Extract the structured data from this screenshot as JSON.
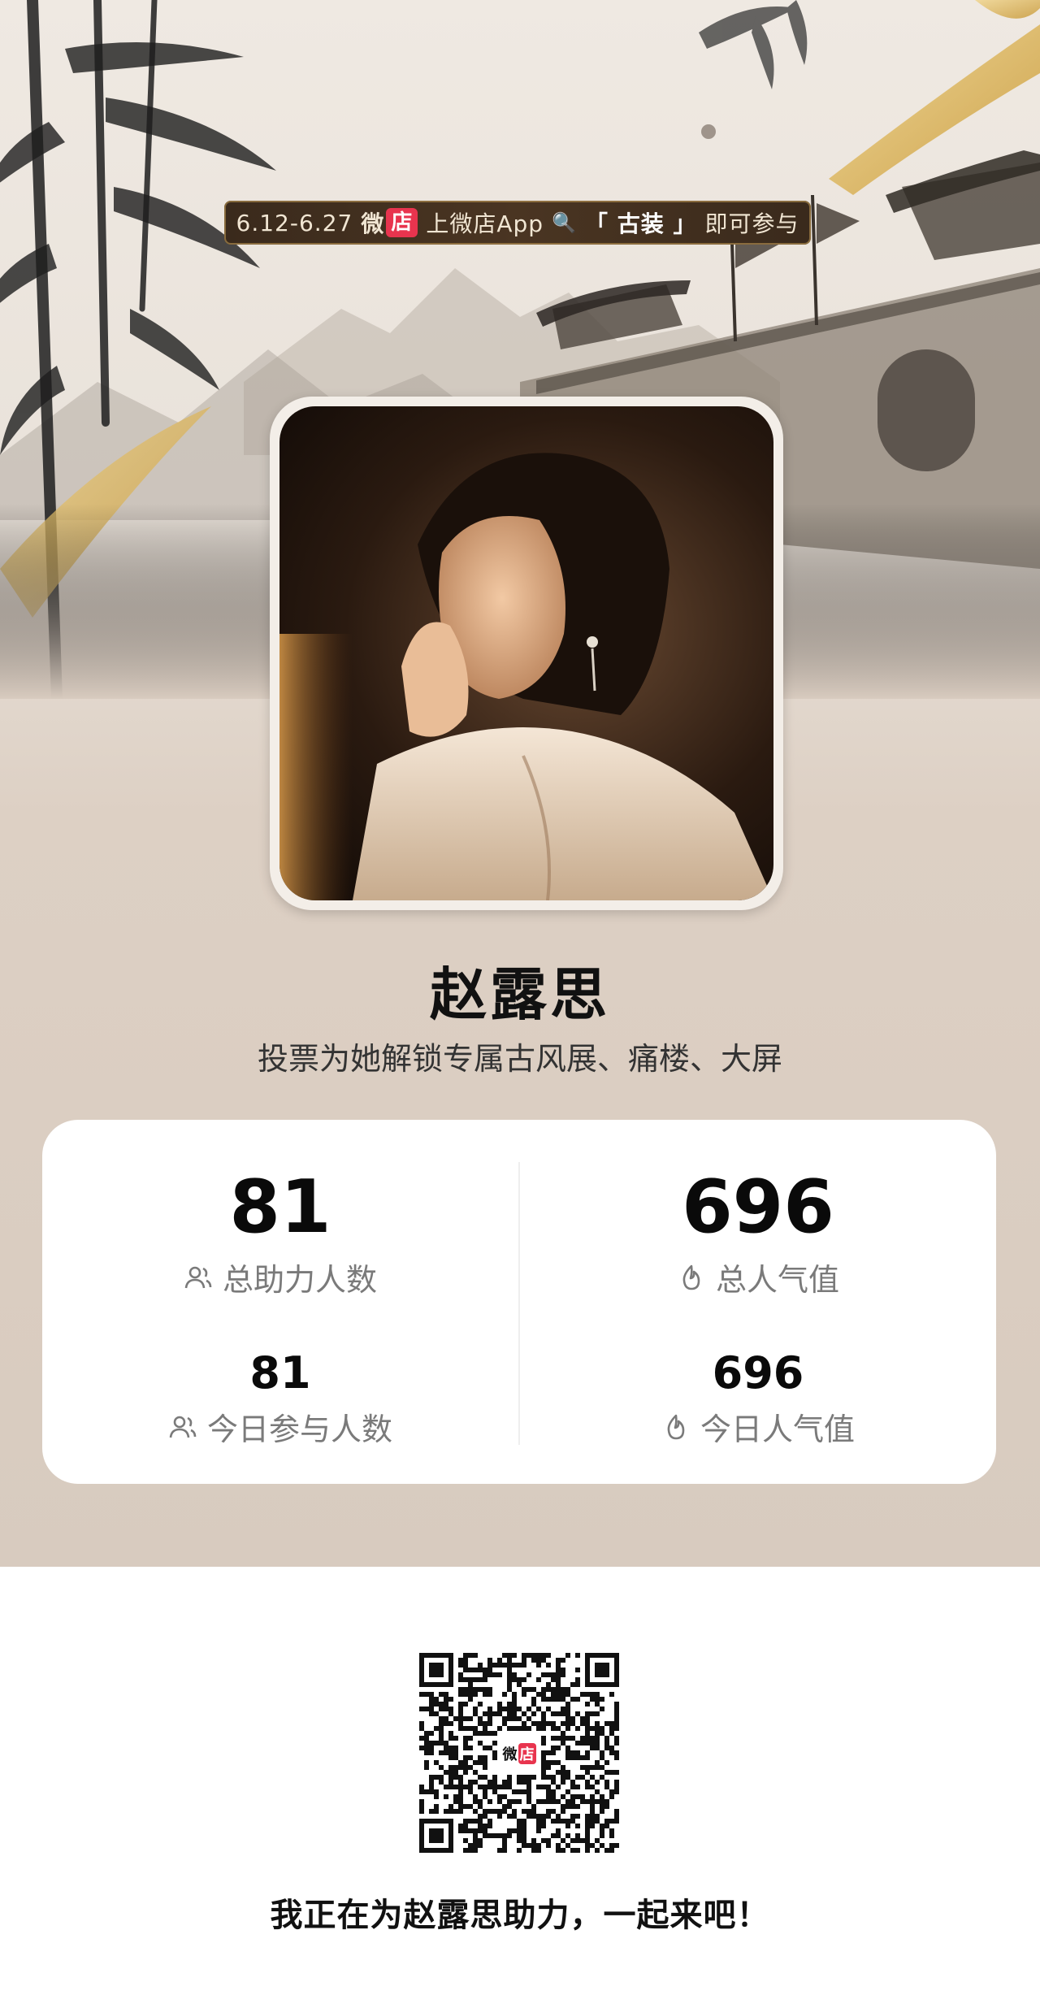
{
  "banner": {
    "dates": "6.12-6.27",
    "shop_prefix": "微",
    "shop_box": "店",
    "app_text": "上微店App",
    "search_icon": "magnifier-icon",
    "keyword": "「 古装 」",
    "suffix": "即可参与"
  },
  "profile": {
    "name": "赵露思",
    "subtitle": "投票为她解锁专属古风展、痛楼、大屏"
  },
  "stats": {
    "total_supporters": {
      "value": "81",
      "label": "总助力人数",
      "icon": "people-icon"
    },
    "total_popularity": {
      "value": "696",
      "label": "总人气值",
      "icon": "flame-icon"
    },
    "today_participants": {
      "value": "81",
      "label": "今日参与人数",
      "icon": "people-icon"
    },
    "today_popularity": {
      "value": "696",
      "label": "今日人气值",
      "icon": "flame-icon"
    }
  },
  "qr": {
    "logo_prefix": "微",
    "logo_box": "店"
  },
  "cta": "我正在为赵露思助力，一起来吧！",
  "colors": {
    "accent": "#e8344e",
    "gold": "#d8b25a",
    "poster_bg": "#d8cbbf",
    "banner_bg": "#3a2a1c"
  }
}
